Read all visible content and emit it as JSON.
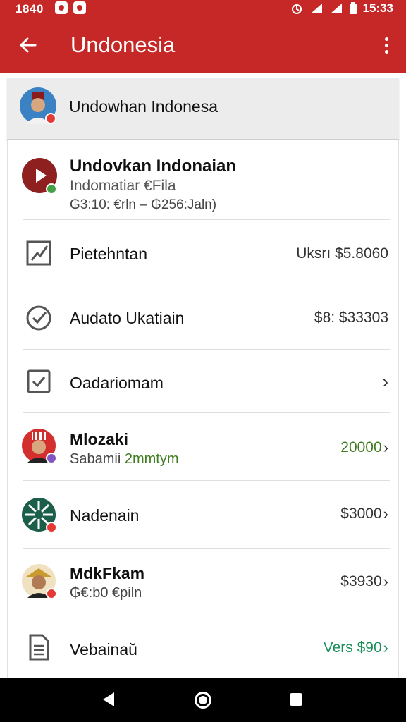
{
  "status_bar": {
    "time_left": "1840",
    "time_right": "15:33"
  },
  "app_bar": {
    "title": "Undonesia",
    "back_icon": "arrow-left-icon",
    "menu_icon": "more-vert-icon"
  },
  "header": {
    "name": "Undowhan Indonesa"
  },
  "featured": {
    "title": "Undovkan Indonaian",
    "subtitle": "Indomatiar €Fila",
    "detail": "₲3:10: €rln – ₲256:Jaln)"
  },
  "menu_rows": [
    {
      "label": "Pietehntan",
      "value": "Uksrı $5.8060",
      "icon": "chart-icon",
      "chevron": false
    },
    {
      "label": "Audato Ukatiain",
      "value": "$8: $33303",
      "icon": "check-circle-icon",
      "chevron": false
    },
    {
      "label": "Oadariomam",
      "value": "",
      "icon": "checkbox-icon",
      "chevron": true
    }
  ],
  "people": [
    {
      "name": "Mlozaki",
      "sub_prefix": "Sabamii",
      "sub_highlight": "2mmtym",
      "value": "20000",
      "value_color": "green"
    },
    {
      "name": "Nadenain",
      "sub_prefix": "",
      "sub_highlight": "",
      "value": "$3000",
      "value_color": "default"
    },
    {
      "name": "MdkFkam",
      "sub_prefix": "₲€:b0 €piln",
      "sub_highlight": "",
      "value": "$3930",
      "value_color": "default"
    }
  ],
  "last_row": {
    "label": "Vebainaŭ",
    "value": "Vers $90",
    "icon": "document-icon"
  },
  "colors": {
    "app_bar": "#c62828",
    "green_value": "#3f7d21",
    "teal_value": "#1a8f5b"
  }
}
